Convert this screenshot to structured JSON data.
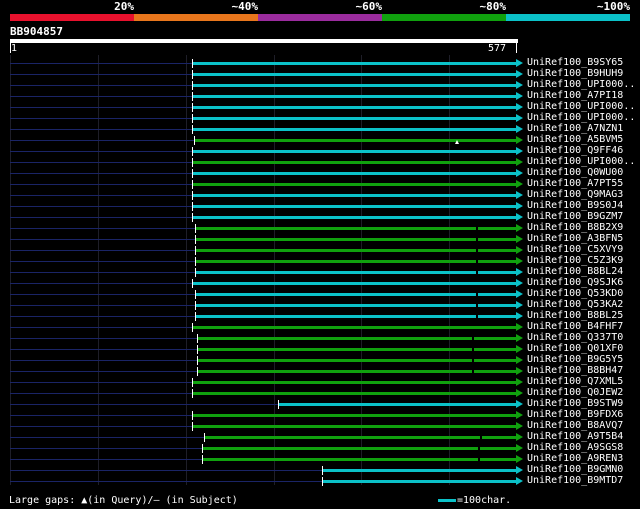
{
  "identity_scale": {
    "labels": [
      "20%",
      "~40%",
      "~60%",
      "~80%",
      "~100%"
    ],
    "colors": [
      "#e8112d",
      "#e8761c",
      "#9b2c9e",
      "#10a10e",
      "#0bc1c8"
    ]
  },
  "query": {
    "id": "BB904857",
    "start": "1",
    "end": "577",
    "length": 577
  },
  "colors": {
    "high": "#0bc1c8",
    "mid": "#10a10e",
    "unaligned": "#1a2466"
  },
  "hits": [
    {
      "label": "UniRef100_B9SY65",
      "start": 208,
      "end": 577,
      "identity": "high"
    },
    {
      "label": "UniRef100_B9HUH9",
      "start": 208,
      "end": 577,
      "identity": "high"
    },
    {
      "label": "UniRef100_UPI000..",
      "start": 208,
      "end": 577,
      "identity": "high"
    },
    {
      "label": "UniRef100_A7PI18",
      "start": 208,
      "end": 577,
      "identity": "high"
    },
    {
      "label": "UniRef100_UPI000..",
      "start": 208,
      "end": 577,
      "identity": "high"
    },
    {
      "label": "UniRef100_UPI000..",
      "start": 208,
      "end": 577,
      "identity": "high"
    },
    {
      "label": "UniRef100_A7NZN1",
      "start": 208,
      "end": 577,
      "identity": "high"
    },
    {
      "label": "UniRef100_A5BVM5",
      "start": 211,
      "end": 577,
      "identity": "mid",
      "gap_query": 508
    },
    {
      "label": "UniRef100_Q9FF46",
      "start": 208,
      "end": 577,
      "identity": "high"
    },
    {
      "label": "UniRef100_UPI000..",
      "start": 208,
      "end": 577,
      "identity": "mid"
    },
    {
      "label": "UniRef100_Q0WU00",
      "start": 208,
      "end": 577,
      "identity": "high"
    },
    {
      "label": "UniRef100_A7PT55",
      "start": 208,
      "end": 577,
      "identity": "mid"
    },
    {
      "label": "UniRef100_Q9MAG3",
      "start": 208,
      "end": 577,
      "identity": "high"
    },
    {
      "label": "UniRef100_B9S0J4",
      "start": 208,
      "end": 577,
      "identity": "high"
    },
    {
      "label": "UniRef100_B9GZM7",
      "start": 208,
      "end": 577,
      "identity": "high"
    },
    {
      "label": "UniRef100_B8B2X9",
      "start": 212,
      "end": 577,
      "identity": "mid",
      "gap_subject": 532
    },
    {
      "label": "UniRef100_A3BFN5",
      "start": 212,
      "end": 577,
      "identity": "mid",
      "gap_subject": 532
    },
    {
      "label": "UniRef100_C5XVY9",
      "start": 212,
      "end": 577,
      "identity": "mid",
      "gap_subject": 532
    },
    {
      "label": "UniRef100_C5Z3K9",
      "start": 212,
      "end": 577,
      "identity": "mid",
      "gap_subject": 532
    },
    {
      "label": "UniRef100_B8BL24",
      "start": 212,
      "end": 577,
      "identity": "high",
      "gap_subject": 532
    },
    {
      "label": "UniRef100_Q9SJK6",
      "start": 208,
      "end": 577,
      "identity": "high"
    },
    {
      "label": "UniRef100_Q53KD0",
      "start": 212,
      "end": 577,
      "identity": "high",
      "gap_subject": 532
    },
    {
      "label": "UniRef100_Q53KA2",
      "start": 212,
      "end": 577,
      "identity": "high",
      "gap_subject": 532
    },
    {
      "label": "UniRef100_B8BL25",
      "start": 212,
      "end": 577,
      "identity": "high",
      "gap_subject": 532
    },
    {
      "label": "UniRef100_B4FHF7",
      "start": 208,
      "end": 577,
      "identity": "mid"
    },
    {
      "label": "UniRef100_Q337T0",
      "start": 214,
      "end": 577,
      "identity": "mid",
      "gap_subject": 527
    },
    {
      "label": "UniRef100_Q01XF0",
      "start": 214,
      "end": 577,
      "identity": "mid",
      "gap_subject": 527
    },
    {
      "label": "UniRef100_B9G5Y5",
      "start": 214,
      "end": 577,
      "identity": "mid",
      "gap_subject": 527
    },
    {
      "label": "UniRef100_B8BH47",
      "start": 214,
      "end": 577,
      "identity": "mid",
      "gap_subject": 527
    },
    {
      "label": "UniRef100_Q7XML5",
      "start": 208,
      "end": 577,
      "identity": "mid"
    },
    {
      "label": "UniRef100_Q0JEW2",
      "start": 208,
      "end": 577,
      "identity": "mid"
    },
    {
      "label": "UniRef100_B9STW9",
      "start": 306,
      "end": 577,
      "identity": "high"
    },
    {
      "label": "UniRef100_B9FDX6",
      "start": 208,
      "end": 577,
      "identity": "mid"
    },
    {
      "label": "UniRef100_B8AVQ7",
      "start": 208,
      "end": 577,
      "identity": "mid"
    },
    {
      "label": "UniRef100_A9T5B4",
      "start": 222,
      "end": 577,
      "identity": "mid",
      "gap_subject": 536
    },
    {
      "label": "UniRef100_A9SGS8",
      "start": 219,
      "end": 577,
      "identity": "mid",
      "gap_subject": 534
    },
    {
      "label": "UniRef100_A9REN3",
      "start": 219,
      "end": 577,
      "identity": "mid",
      "gap_subject": 534
    },
    {
      "label": "UniRef100_B9GMN0",
      "start": 356,
      "end": 577,
      "identity": "high"
    },
    {
      "label": "UniRef100_B9MTD7",
      "start": 356,
      "end": 577,
      "identity": "high"
    }
  ],
  "legend": {
    "gaps_text": "Large gaps: ▲(in Query)/– (in Subject)",
    "scale_text": "=100char."
  }
}
